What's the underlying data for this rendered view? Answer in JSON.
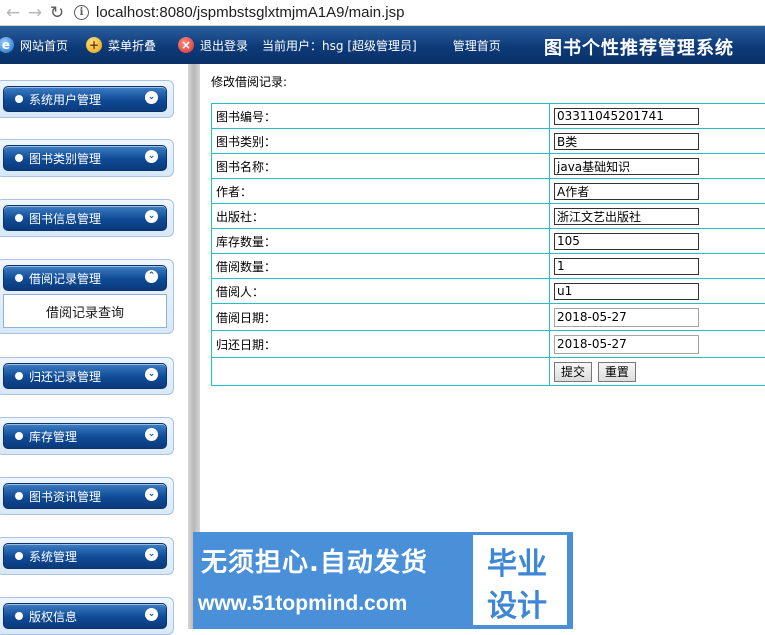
{
  "browser": {
    "back_icon": "arrow-left-icon",
    "forward_icon": "arrow-right-icon",
    "reload_icon": "reload-icon",
    "url": "localhost:8080/jspmbstsglxtmjmA1A9/main.jsp"
  },
  "header": {
    "site_home": "网站首页",
    "menu_fold": "菜单折叠",
    "logout": "退出登录",
    "current_user": "当前用户：hsg [超级管理员]",
    "admin_home": "管理首页",
    "system_title": "图书个性推荐管理系统"
  },
  "sidebar": {
    "items": [
      {
        "label": "系统用户管理"
      },
      {
        "label": "图书类别管理"
      },
      {
        "label": "图书信息管理"
      },
      {
        "label": "借阅记录管理",
        "sub": "借阅记录查询"
      },
      {
        "label": "归还记录管理"
      },
      {
        "label": "库存管理"
      },
      {
        "label": "图书资讯管理"
      },
      {
        "label": "系统管理"
      },
      {
        "label": "版权信息"
      }
    ]
  },
  "form": {
    "title": "修改借阅记录:",
    "rows": [
      {
        "label": "图书编号：",
        "value": "03311045201741"
      },
      {
        "label": "图书类别：",
        "value": "B类"
      },
      {
        "label": "图书名称：",
        "value": "java基础知识"
      },
      {
        "label": "作者：",
        "value": "A作者"
      },
      {
        "label": "出版社：",
        "value": "浙江文艺出版社"
      },
      {
        "label": "库存数量：",
        "value": "105"
      },
      {
        "label": "借阅数量：",
        "value": "1"
      },
      {
        "label": "借阅人：",
        "value": "u1"
      },
      {
        "label": "借阅日期：",
        "value": "2018-05-27"
      },
      {
        "label": "归还日期：",
        "value": "2018-05-27"
      }
    ],
    "submit_label": "提交",
    "reset_label": "重置"
  },
  "watermark": {
    "line1": "无须担心.自动发货",
    "line2": "www.51topmind.com",
    "box1": "毕业",
    "box2": "设计"
  },
  "colors": {
    "header_bg": "#0d3a78",
    "table_border": "#21c1c7",
    "menu_btn": "#0f4a96",
    "watermark_bg": "#4a90d9"
  }
}
